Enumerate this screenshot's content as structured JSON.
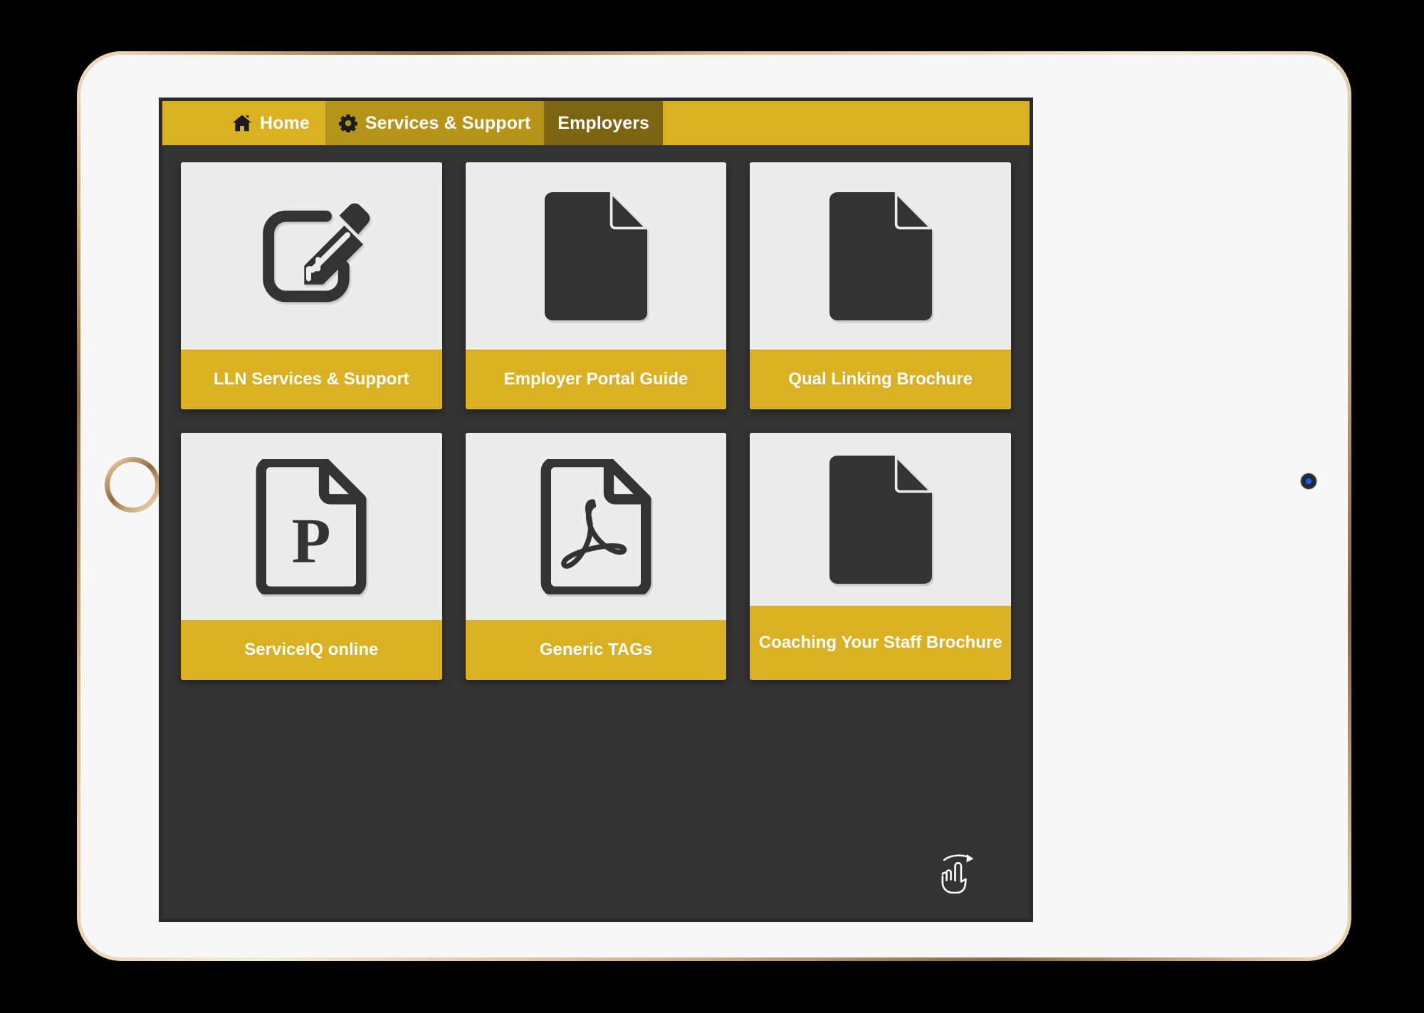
{
  "device": {
    "type": "tablet",
    "bezel_color": "#c9a878",
    "body_color": "#f7f7f7",
    "home_button": "home-button",
    "camera": "front-camera"
  },
  "app": {
    "background_color": "#333333",
    "accent_color": "#d9b122",
    "accent_mid_color": "#b59419",
    "accent_dark_color": "#7d6410",
    "card_face_color": "#ececec",
    "icon_color": "#333333"
  },
  "navbar": {
    "tabs": [
      {
        "label": "Home",
        "icon": "home-icon",
        "level": "home",
        "active": false
      },
      {
        "label": "Services & Support",
        "icon": "gear-icon",
        "level": "level2",
        "active": false
      },
      {
        "label": "Employers",
        "icon": "",
        "level": "level3",
        "active": true
      }
    ]
  },
  "grid": {
    "cards": [
      {
        "label": "LLN Services & Support",
        "icon": "edit-document-icon"
      },
      {
        "label": "Employer Portal Guide",
        "icon": "document-filled-icon"
      },
      {
        "label": "Qual Linking Brochure",
        "icon": "document-filled-icon"
      },
      {
        "label": "ServiceIQ online",
        "icon": "powerpoint-document-icon"
      },
      {
        "label": "Generic TAGs",
        "icon": "pdf-document-icon"
      },
      {
        "label": "Coaching Your Staff Brochure",
        "icon": "document-filled-icon",
        "two_line": true
      }
    ]
  },
  "footer": {
    "swipe_hint_icon": "swipe-right-hand-icon"
  }
}
